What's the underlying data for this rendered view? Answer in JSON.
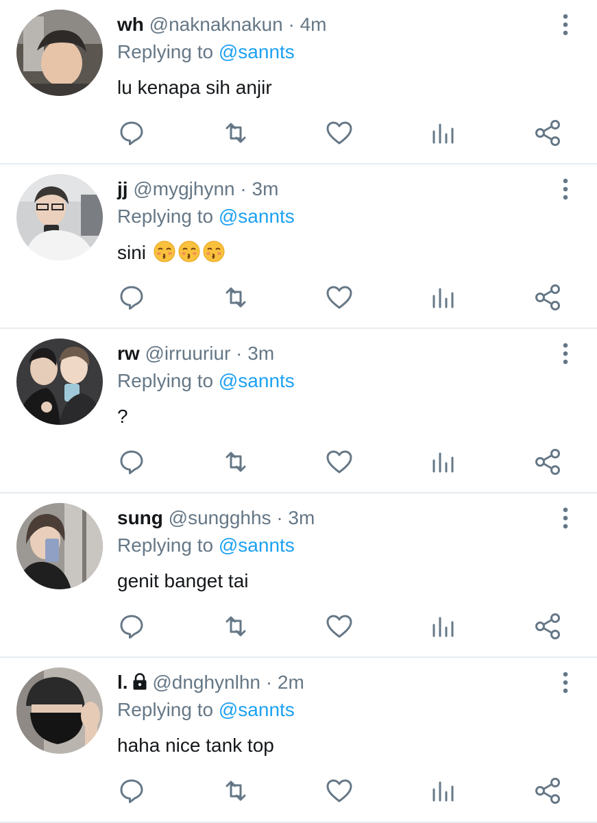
{
  "colors": {
    "accent": "#1da1f2",
    "muted": "#657786",
    "text": "#14171a",
    "divider": "#e6ecf0"
  },
  "replies": [
    {
      "name": "wh",
      "handle": "@naknaknakun",
      "separator": "·",
      "time": "4m",
      "replying_prefix": "Replying to",
      "replying_to": "@sannts",
      "text": "lu kenapa sih anjir",
      "avatar": "avatar-photo"
    },
    {
      "name": "jj",
      "handle": "@mygjhynn",
      "separator": "·",
      "time": "3m",
      "replying_prefix": "Replying to",
      "replying_to": "@sannts",
      "text": "sini",
      "emoji": "kissing-face-with-closed-eyes x3",
      "avatar": "avatar-photo"
    },
    {
      "name": "rw",
      "handle": "@irruuriur",
      "separator": "·",
      "time": "3m",
      "replying_prefix": "Replying to",
      "replying_to": "@sannts",
      "text": "?",
      "avatar": "avatar-photo"
    },
    {
      "name": "sung",
      "handle": "@sunggh hs",
      "separator": "·",
      "time": "3m",
      "replying_prefix": "Replying to",
      "replying_to": "@sannts",
      "text": "genit banget tai",
      "avatar": "avatar-photo"
    },
    {
      "name": "l.",
      "protected": true,
      "handle": "@dnghynlhn",
      "separator": "·",
      "time": "2m",
      "replying_prefix": "Replying to",
      "replying_to": "@sannts",
      "text": "haha nice tank top",
      "avatar": "avatar-photo"
    }
  ],
  "icons": {
    "more": "more-vertical-icon",
    "reply": "reply-icon",
    "retweet": "retweet-icon",
    "like": "heart-icon",
    "analytics": "analytics-icon",
    "share": "share-icon"
  }
}
